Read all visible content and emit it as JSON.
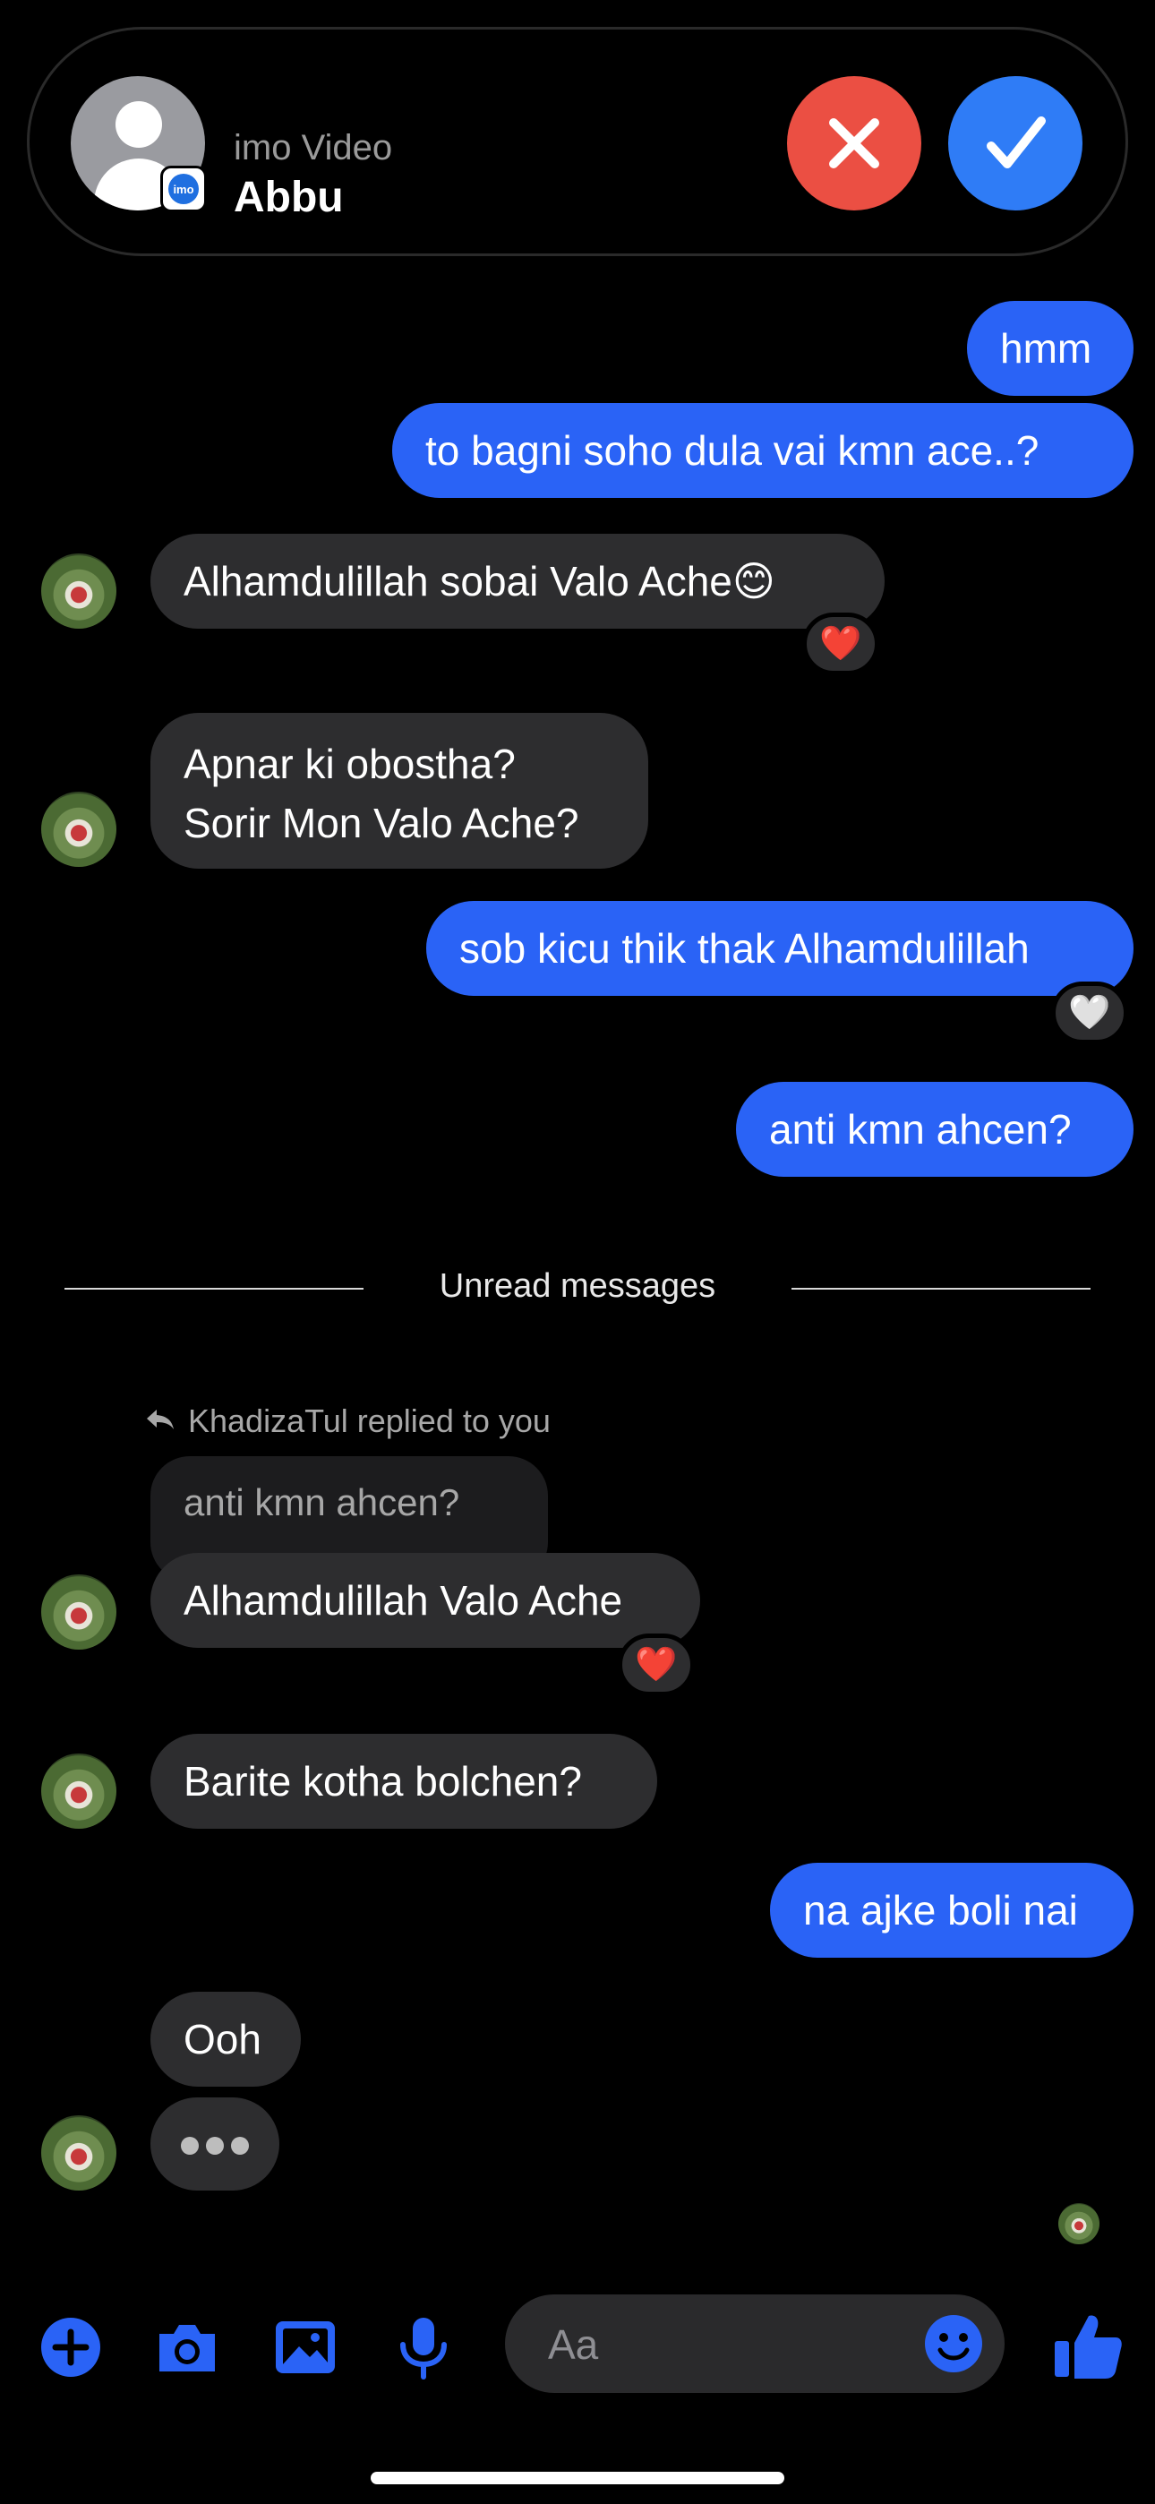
{
  "colors": {
    "accent": "#2a63f6",
    "incoming_bubble": "#2d2d2f",
    "decline": "#eb4f43",
    "accept": "#2f7cf6",
    "background": "#000000"
  },
  "call_banner": {
    "app_label": "imo Video",
    "caller_name": "Abbu",
    "badge_text": "imo",
    "decline_icon": "close-icon",
    "accept_icon": "checkmark-icon"
  },
  "messages": [
    {
      "side": "me",
      "text": "hmm"
    },
    {
      "side": "me",
      "text": "to bagni soho dula vai kmn ace..?"
    },
    {
      "side": "them",
      "text": "Alhamdulillah sobai Valo Ache😊",
      "reaction": "❤️"
    },
    {
      "side": "them",
      "text_lines": [
        "Apnar ki obostha?",
        "Sorir Mon Valo Ache?"
      ]
    },
    {
      "side": "me",
      "text": "sob kicu thik thak Alhamdulillah",
      "reaction": "🤍"
    },
    {
      "side": "me",
      "text": "anti kmn ahcen?"
    },
    {
      "side": "them",
      "text": "Alhamdulillah Valo Ache",
      "reaction": "❤️"
    },
    {
      "side": "them",
      "text": "Barite kotha bolchen?"
    },
    {
      "side": "me",
      "text": "na ajke boli nai"
    },
    {
      "side": "them",
      "text": "Ooh"
    }
  ],
  "divider": {
    "label": "Unread messages"
  },
  "reply": {
    "context": "KhadizaTul replied to you",
    "quoted": "anti kmn ahcen?"
  },
  "composer": {
    "placeholder": "Aa",
    "icons": [
      "plus-icon",
      "camera-icon",
      "image-icon",
      "microphone-icon",
      "emoji-icon",
      "thumbs-up-icon"
    ]
  }
}
